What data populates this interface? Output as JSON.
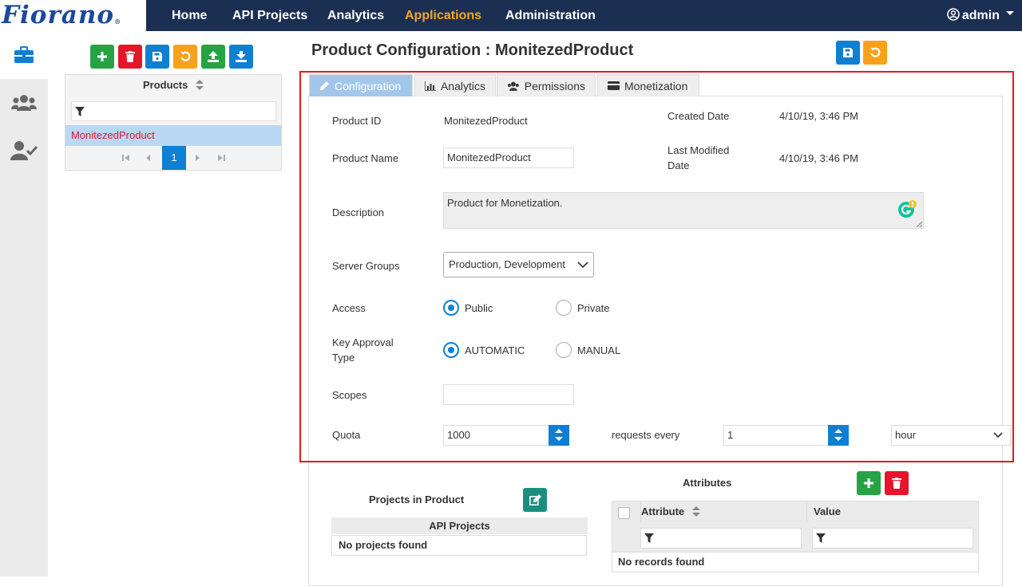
{
  "brand": {
    "logo": "Fiorano",
    "registered": "®"
  },
  "nav": {
    "items": [
      {
        "label": "Home"
      },
      {
        "label": "API Projects"
      },
      {
        "label": "Analytics"
      },
      {
        "label": "Applications",
        "active": true
      },
      {
        "label": "Administration"
      }
    ],
    "user": "admin"
  },
  "left_rail": {
    "items": [
      "briefcase-icon",
      "users-icon",
      "user-check-icon"
    ]
  },
  "product_toolbar": [
    "add",
    "delete",
    "save",
    "refresh",
    "upload",
    "download"
  ],
  "products_grid": {
    "header": "Products",
    "rows": [
      "MonitezedProduct"
    ],
    "page": "1"
  },
  "page_title": "Product Configuration : MonitezedProduct",
  "tabs": [
    {
      "label": "Configuration",
      "icon": "pencil-icon",
      "active": true
    },
    {
      "label": "Analytics",
      "icon": "bar-chart-icon"
    },
    {
      "label": "Permissions",
      "icon": "users-icon"
    },
    {
      "label": "Monetization",
      "icon": "credit-card-icon"
    }
  ],
  "form": {
    "product_id_label": "Product ID",
    "product_id": "MonitezedProduct",
    "created_label": "Created Date",
    "created": "4/10/19, 3:46 PM",
    "product_name_label": "Product Name",
    "product_name": "MonitezedProduct",
    "modified_label_1": "Last Modified",
    "modified_label_2": "Date",
    "modified": "4/10/19, 3:46 PM",
    "description_label": "Description",
    "description": "Product for Monetization.",
    "server_groups_label": "Server Groups",
    "server_groups": "Production, Development",
    "access_label": "Access",
    "access_public": "Public",
    "access_private": "Private",
    "key_approval_label_1": "Key Approval",
    "key_approval_label_2": "Type",
    "key_auto": "AUTOMATIC",
    "key_manual": "MANUAL",
    "scopes_label": "Scopes",
    "scopes": "",
    "quota_label": "Quota",
    "quota": "1000",
    "requests_every": "requests every",
    "interval": "1",
    "unit": "hour"
  },
  "projects": {
    "title": "Projects in Product",
    "column": "API Projects",
    "empty": "No projects found"
  },
  "attributes": {
    "title": "Attributes",
    "col_attribute": "Attribute",
    "col_value": "Value",
    "empty": "No records found"
  },
  "colors": {
    "nav_bg": "#1b2f52",
    "accent": "#f5a623",
    "primary": "#0f7fd1",
    "danger": "#e5152b",
    "success": "#26a344"
  }
}
